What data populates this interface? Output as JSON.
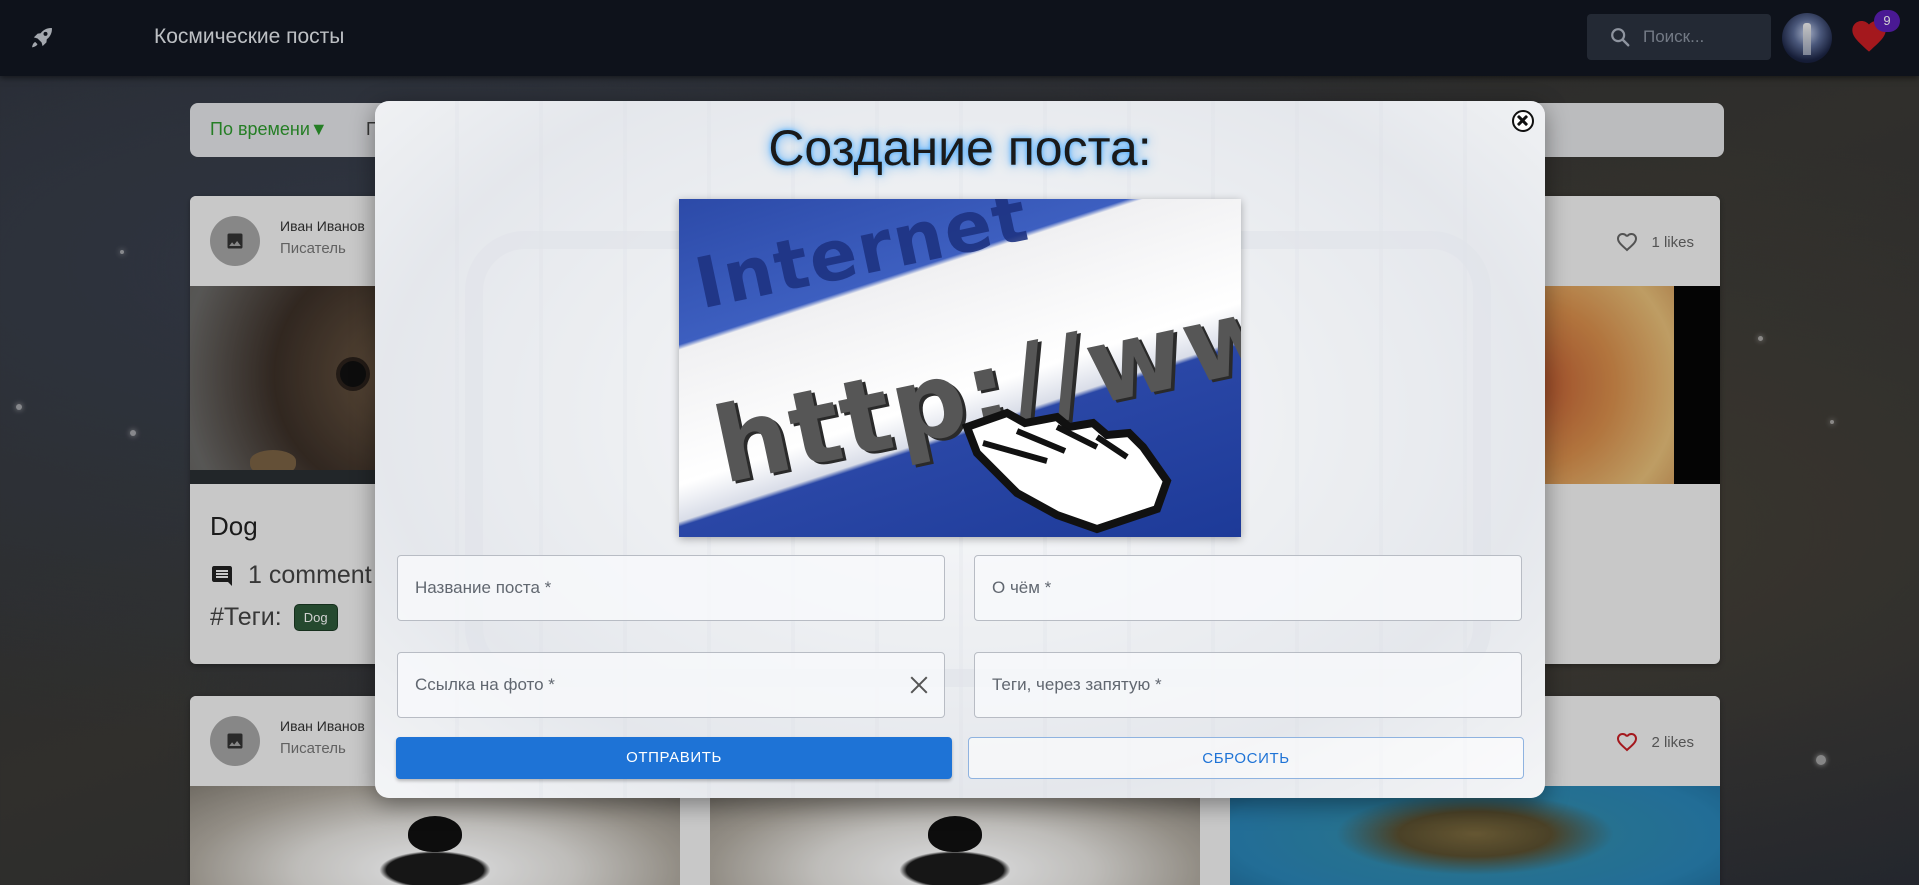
{
  "header": {
    "app_title": "Космические посты",
    "search_placeholder": "Поиск...",
    "notification_count": "9"
  },
  "sortbar": {
    "active_sort": "По времени▼",
    "other_sort_partial": "П"
  },
  "cards": [
    {
      "author": "Иван Иванов",
      "role": "Писатель",
      "title": "Dog",
      "comments": "1 comment",
      "tags_label": "#Теги:",
      "tags": [
        "Dog"
      ]
    },
    {
      "likes": "1 likes"
    },
    {
      "author": "Иван Иванов",
      "role": "Писатель",
      "likes": "2 likes"
    }
  ],
  "modal": {
    "title": "Создание поста:",
    "preview_text_1": "Internet",
    "preview_text_2": "http://www",
    "fields": {
      "post_title_placeholder": "Название поста *",
      "about_placeholder": "О чём *",
      "photo_url_placeholder": "Ссылка на фото *",
      "tags_placeholder": "Теги, через запятую *"
    },
    "submit_label": "ОТПРАВИТЬ",
    "reset_label": "СБРОСИТЬ"
  },
  "colors": {
    "header_bg": "#121722",
    "accent_blue": "#1e73d6",
    "sort_active": "#2e9a2e",
    "heart_red": "#c81e24",
    "badge_purple": "#5b1fb5",
    "tag_green": "#2e5a3a"
  },
  "icons": {
    "logo": "rocket-icon",
    "search": "search-icon",
    "favorites": "heart-icon",
    "close": "close-icon",
    "comments": "comment-icon",
    "avatar_placeholder": "image-icon"
  }
}
